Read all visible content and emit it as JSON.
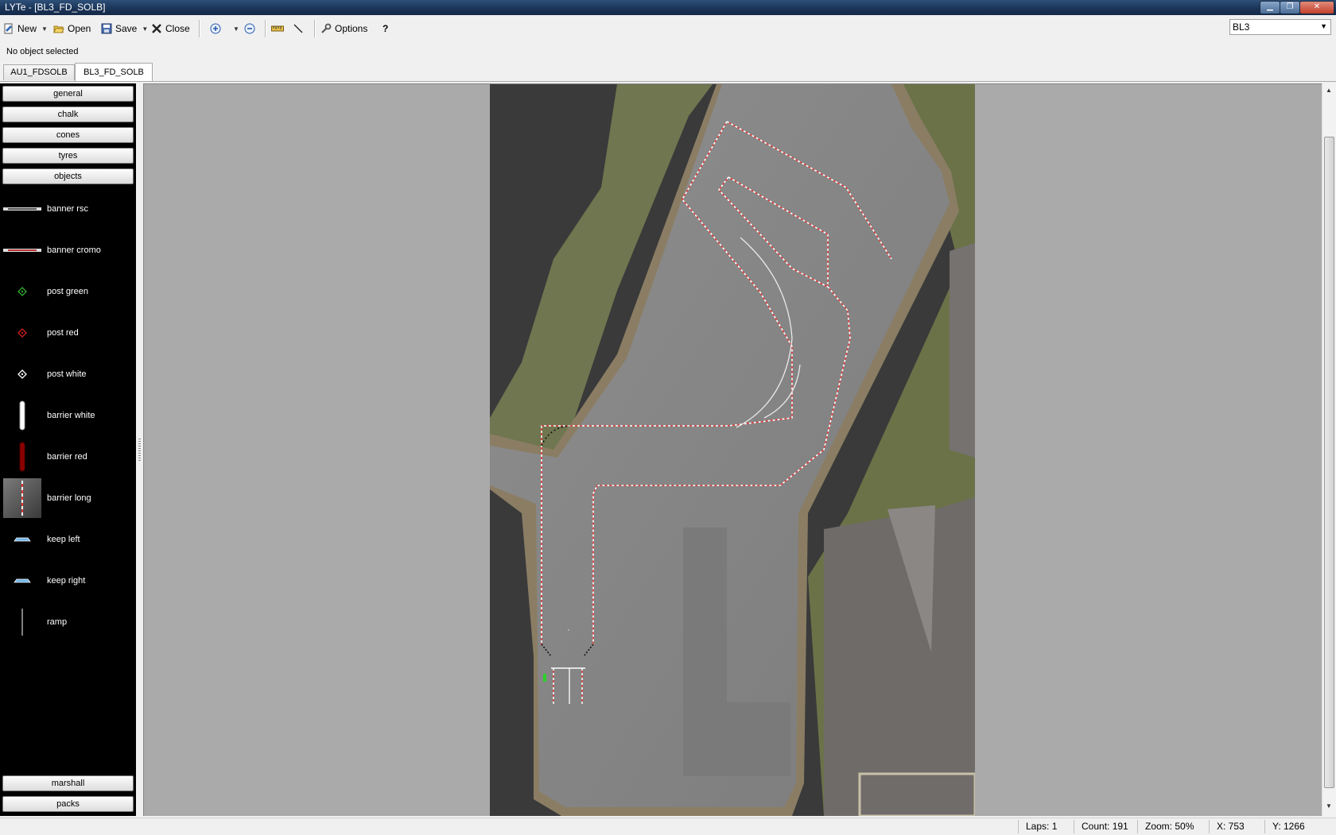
{
  "window": {
    "title": "LYTe - [BL3_FD_SOLB]"
  },
  "toolbar": {
    "new_label": "New",
    "open_label": "Open",
    "save_label": "Save",
    "close_label": "Close",
    "options_label": "Options",
    "help_label": "?",
    "layout_selected": "BL3"
  },
  "selection_status": "No object selected",
  "tabs": [
    {
      "label": "AU1_FDSOLB",
      "active": false
    },
    {
      "label": "BL3_FD_SOLB",
      "active": true
    }
  ],
  "categories": {
    "top": [
      "general",
      "chalk",
      "cones",
      "tyres",
      "objects"
    ],
    "bottom": [
      "marshall",
      "packs"
    ]
  },
  "objects": [
    {
      "label": "banner rsc",
      "icon": "banner-rsc-icon"
    },
    {
      "label": "banner cromo",
      "icon": "banner-cromo-icon"
    },
    {
      "label": "post green",
      "icon": "post-green-icon",
      "color": "#2fae2f"
    },
    {
      "label": "post red",
      "icon": "post-red-icon",
      "color": "#d02020"
    },
    {
      "label": "post white",
      "icon": "post-white-icon",
      "color": "#ffffff"
    },
    {
      "label": "barrier white",
      "icon": "barrier-white-icon",
      "color": "#ffffff"
    },
    {
      "label": "barrier red",
      "icon": "barrier-red-icon",
      "color": "#8b0000"
    },
    {
      "label": "barrier long",
      "icon": "barrier-long-icon"
    },
    {
      "label": "keep left",
      "icon": "keep-left-icon",
      "color": "#6fb6e8"
    },
    {
      "label": "keep right",
      "icon": "keep-right-icon",
      "color": "#6fb6e8"
    },
    {
      "label": "ramp",
      "icon": "ramp-icon"
    }
  ],
  "status": {
    "laps": "Laps: 1",
    "count": "Count: 191",
    "zoom": "Zoom: 50%",
    "x": "X: 753",
    "y": "Y: 1266"
  }
}
